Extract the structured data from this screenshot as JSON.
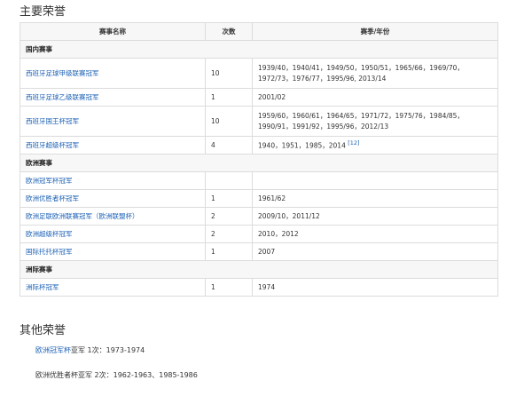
{
  "sections": {
    "main_title": "主要荣誉",
    "other_title": "其他荣誉"
  },
  "table": {
    "headers": [
      "赛事名称",
      "次数",
      "赛季/年份"
    ],
    "groups": {
      "domestic": "国内赛事",
      "europe": "欧洲赛事",
      "intercontinental": "洲际赛事"
    },
    "rows": [
      {
        "name": "西班牙足球甲级联赛冠军",
        "count": "10",
        "years_line1": "1939/40，1940/41，1949/50，1950/51，1965/66，1969/70，",
        "years_line2": "1972/73，1976/77，1995/96, 2013/14"
      },
      {
        "name": "西班牙足球乙级联赛冠军",
        "count": "1",
        "years": "2001/02"
      },
      {
        "name": "西班牙国王杯冠军",
        "count": "10",
        "years_line1": "1959/60，1960/61，1964/65，1971/72，1975/76，1984/85，",
        "years_line2": "1990/91，1991/92，1995/96，2012/13"
      },
      {
        "name": "西班牙超级杯冠军",
        "count": "4",
        "years": "1940，1951，1985，2014",
        "ref": "[12]"
      },
      {
        "name": "欧洲冠军杯冠军",
        "count": "",
        "years": ""
      },
      {
        "name": "欧洲优胜者杯冠军",
        "count": "1",
        "years": "1961/62"
      },
      {
        "name": "欧洲足联欧洲联赛冠军（欧洲联盟杯）",
        "count": "2",
        "years": "2009/10，2011/12"
      },
      {
        "name": "欧洲超级杯冠军",
        "count": "2",
        "years": "2010，2012"
      },
      {
        "name": "国际托托杯冠军",
        "count": "1",
        "years": "2007"
      },
      {
        "name": "洲际杯冠军",
        "count": "1",
        "years": "1974"
      }
    ]
  },
  "other": {
    "item1_link": "欧洲冠军杯",
    "item1_rest": "亚军 1次：1973-1974",
    "item2": "欧洲优胜者杯亚军 2次：1962-1963、1985-1986"
  },
  "colors": {
    "link": "#1a5fb4",
    "header_bg": "#f7f7f7",
    "border": "#dcdcdc"
  }
}
